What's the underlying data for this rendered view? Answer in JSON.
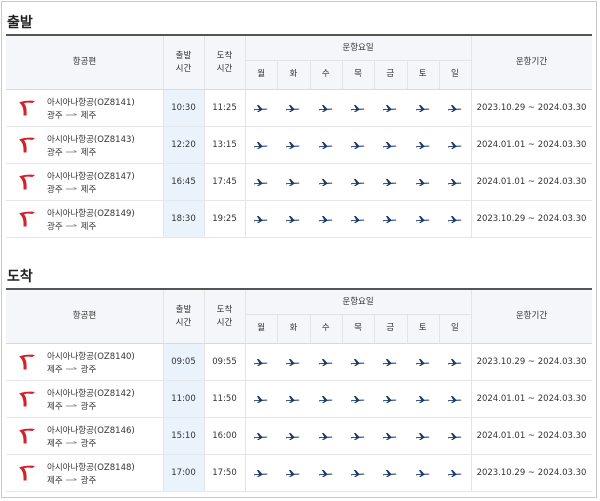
{
  "colors": {
    "accent": "#1b3a6b",
    "logo": "#d2232a",
    "highlight": "#eaf3fc"
  },
  "header": {
    "airline_col": "항공편",
    "dep_col": [
      "출발",
      "시간"
    ],
    "arr_col": [
      "도착",
      "시간"
    ],
    "days_title": "운항요일",
    "days": [
      "월",
      "화",
      "수",
      "목",
      "금",
      "토",
      "일"
    ],
    "period_col": "운항기간"
  },
  "sections": [
    {
      "title": "출발",
      "rows": [
        {
          "airline": "아시아나항공(OZ8141)",
          "from": "광주",
          "to": "제주",
          "dep": "10:30",
          "arr": "11:25",
          "period": "2023.10.29 ~ 2024.03.30",
          "days": [
            "plane-icon",
            "plane-icon",
            "plane-icon",
            "plane-icon",
            "plane-icon",
            "plane-icon",
            "plane-icon"
          ]
        },
        {
          "airline": "아시아나항공(OZ8143)",
          "from": "광주",
          "to": "제주",
          "dep": "12:20",
          "arr": "13:15",
          "period": "2024.01.01 ~ 2024.03.30",
          "days": [
            "plane-icon",
            "plane-icon",
            "plane-icon",
            "plane-icon",
            "plane-icon",
            "plane-icon",
            "plane-icon"
          ]
        },
        {
          "airline": "아시아나항공(OZ8147)",
          "from": "광주",
          "to": "제주",
          "dep": "16:45",
          "arr": "17:45",
          "period": "2024.01.01 ~ 2024.03.30",
          "days": [
            "plane-icon",
            "plane-icon",
            "plane-icon",
            "plane-icon",
            "plane-icon",
            "plane-icon",
            "plane-icon"
          ]
        },
        {
          "airline": "아시아나항공(OZ8149)",
          "from": "광주",
          "to": "제주",
          "dep": "18:30",
          "arr": "19:25",
          "period": "2023.10.29 ~ 2024.03.30",
          "days": [
            "plane-icon",
            "plane-icon",
            "plane-icon",
            "plane-icon",
            "plane-icon",
            "plane-icon",
            "plane-icon"
          ]
        }
      ]
    },
    {
      "title": "도착",
      "rows": [
        {
          "airline": "아시아나항공(OZ8140)",
          "from": "제주",
          "to": "광주",
          "dep": "09:05",
          "arr": "09:55",
          "period": "2023.10.29 ~ 2024.03.30",
          "days": [
            "plane-icon",
            "plane-icon",
            "plane-icon",
            "plane-icon",
            "plane-icon",
            "plane-icon",
            "plane-icon"
          ]
        },
        {
          "airline": "아시아나항공(OZ8142)",
          "from": "제주",
          "to": "광주",
          "dep": "11:00",
          "arr": "11:50",
          "period": "2024.01.01 ~ 2024.03.30",
          "days": [
            "plane-icon",
            "plane-icon",
            "plane-icon",
            "plane-icon",
            "plane-icon",
            "plane-icon",
            "plane-icon"
          ]
        },
        {
          "airline": "아시아나항공(OZ8146)",
          "from": "제주",
          "to": "광주",
          "dep": "15:10",
          "arr": "16:00",
          "period": "2024.01.01 ~ 2024.03.30",
          "days": [
            "plane-icon",
            "plane-icon",
            "plane-icon",
            "plane-icon",
            "plane-icon",
            "plane-icon",
            "plane-icon"
          ]
        },
        {
          "airline": "아시아나항공(OZ8148)",
          "from": "제주",
          "to": "광주",
          "dep": "17:00",
          "arr": "17:50",
          "period": "2023.10.29 ~ 2024.03.30",
          "days": [
            "plane-icon",
            "plane-icon",
            "plane-icon",
            "plane-icon",
            "plane-icon",
            "plane-icon",
            "plane-icon"
          ]
        }
      ]
    }
  ]
}
